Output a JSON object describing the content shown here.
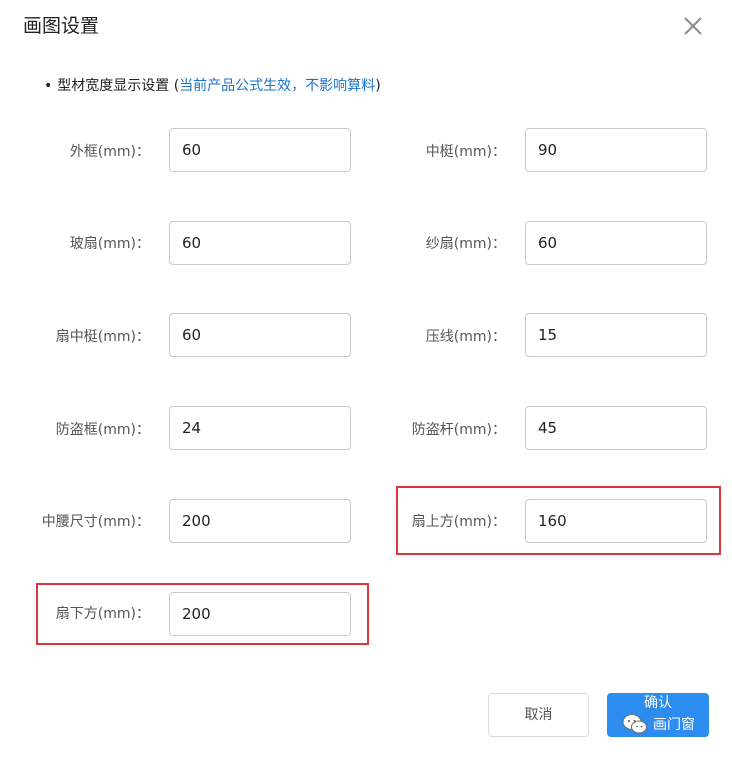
{
  "dialog": {
    "title": "画图设置",
    "close_icon": "close-icon"
  },
  "section": {
    "bullet": "•",
    "heading": "型材宽度显示设置",
    "note_open": "(",
    "note": "当前产品公式生效，不影响算料",
    "note_close": ")"
  },
  "fields": {
    "outer_frame": {
      "label": "外框(mm)：",
      "value": "60"
    },
    "mullion": {
      "label": "中梃(mm)：",
      "value": "90"
    },
    "glass_sash": {
      "label": "玻扇(mm)：",
      "value": "60"
    },
    "screen_sash": {
      "label": "纱扇(mm)：",
      "value": "60"
    },
    "sash_mullion": {
      "label": "扇中梃(mm)：",
      "value": "60"
    },
    "bead": {
      "label": "压线(mm)：",
      "value": "15"
    },
    "security_frame": {
      "label": "防盗框(mm)：",
      "value": "24"
    },
    "security_bar": {
      "label": "防盗杆(mm)：",
      "value": "45"
    },
    "middle_waist": {
      "label": "中腰尺寸(mm)：",
      "value": "200"
    },
    "sash_top": {
      "label": "扇上方(mm)：",
      "value": "160"
    },
    "sash_bottom": {
      "label": "扇下方(mm)：",
      "value": "200"
    }
  },
  "buttons": {
    "cancel": "取消",
    "confirm": "确认"
  },
  "watermark": {
    "icon": "wechat-icon",
    "text": "画门窗"
  },
  "colors": {
    "primary": "#2d8cf0",
    "note": "#1a73c8",
    "highlight": "#d9363e"
  }
}
